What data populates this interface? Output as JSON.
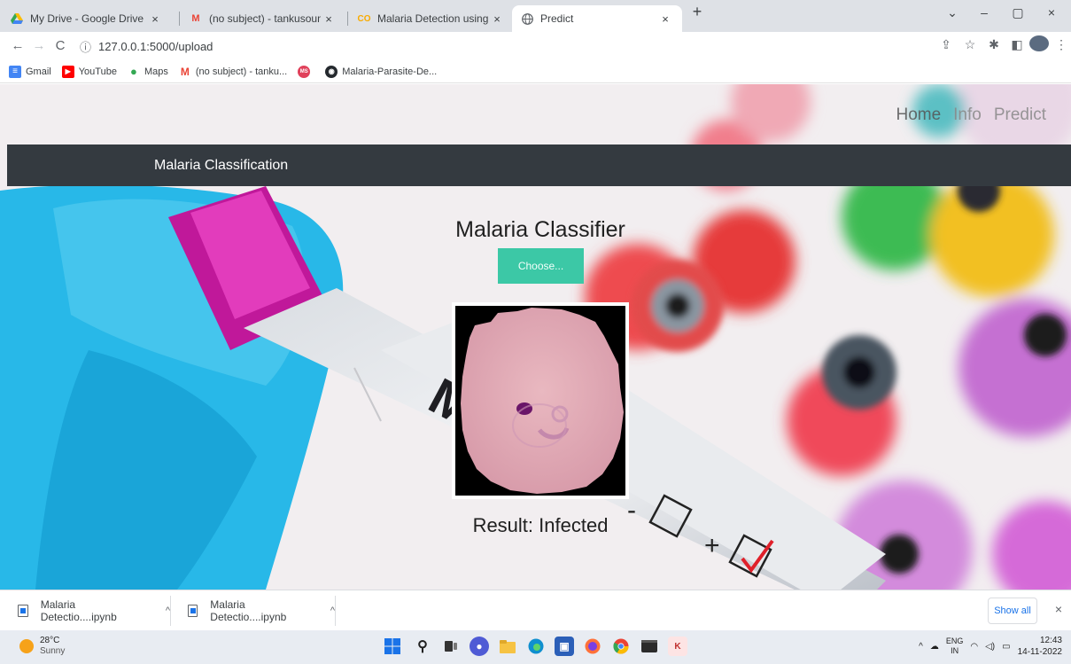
{
  "browser": {
    "tabs": [
      {
        "title": "My Drive - Google Drive",
        "icon": "google-drive-icon",
        "close": "×"
      },
      {
        "title": "(no subject) - tankusoumya@gm",
        "icon": "gmail-icon",
        "close": "×"
      },
      {
        "title": "Malaria Detection using DL.ipynb",
        "icon": "colab-icon",
        "close": "×"
      },
      {
        "title": "Predict",
        "icon": "globe-icon",
        "close": "×",
        "active": true
      }
    ],
    "new_tab": "+",
    "window_controls": {
      "dropdown": "⌄",
      "minimize": "–",
      "maximize": "▢",
      "close": "×"
    },
    "address": "127.0.0.1:5000/upload",
    "nav": {
      "back": "←",
      "forward": "→",
      "reload": "C",
      "info": "ⓘ"
    },
    "toolbar_icons": {
      "share": "⇪",
      "star": "☆",
      "extensions": "✱",
      "sidepanel": "◧",
      "menu": "⋮"
    },
    "bookmarks": [
      {
        "label": "Gmail",
        "icon": "docs-icon",
        "color": "#4285f4"
      },
      {
        "label": "YouTube",
        "icon": "youtube-icon",
        "color": "#ff0000"
      },
      {
        "label": "Maps",
        "icon": "maps-icon",
        "color": "#34a853"
      },
      {
        "label": "(no subject) - tanku...",
        "icon": "gmail-icon",
        "color": "#ea4335"
      },
      {
        "label": "",
        "icon": "ms-icon",
        "color": "#e0405a"
      },
      {
        "label": "Malaria-Parasite-De...",
        "icon": "github-icon",
        "color": "#24292e"
      }
    ]
  },
  "page": {
    "top_nav": {
      "home": "Home",
      "info": "Info",
      "predict": "Predict"
    },
    "navbar_brand": "Malaria Classification",
    "title": "Malaria Classifier",
    "choose_button": "Choose...",
    "result": "Result: Infected",
    "accent_color": "#3cc8a6"
  },
  "downloads": {
    "items": [
      {
        "name": "Malaria Detectio....ipynb",
        "caret": "^"
      },
      {
        "name": "Malaria Detectio....ipynb",
        "caret": "^"
      }
    ],
    "show_all": "Show all",
    "close": "×"
  },
  "taskbar": {
    "weather_temp": "28°C",
    "weather_desc": "Sunny",
    "lang_top": "ENG",
    "lang_bottom": "IN",
    "tray_caret": "^",
    "time": "12:43",
    "date": "14-11-2022"
  }
}
